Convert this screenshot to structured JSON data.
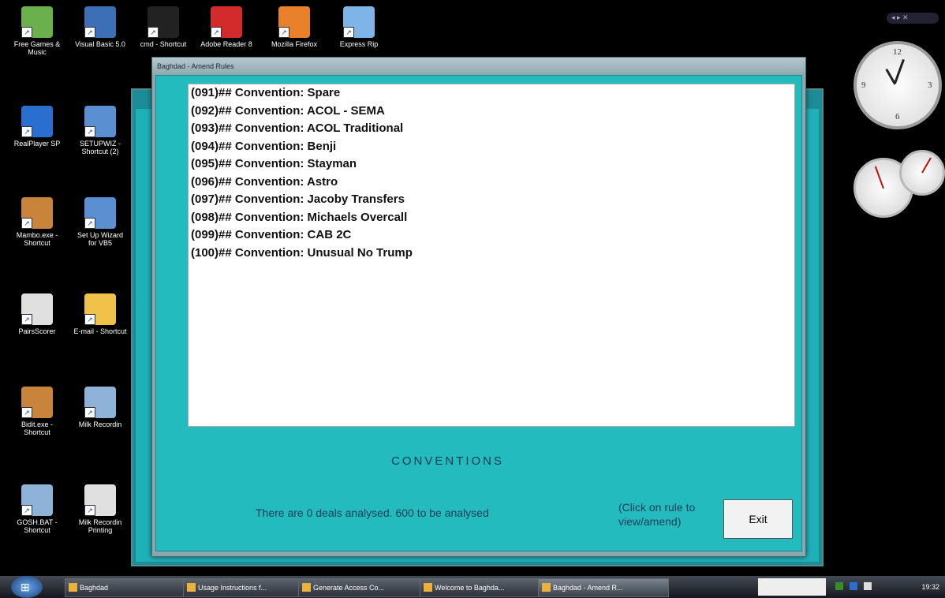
{
  "desktop": {
    "icons": [
      {
        "label": "Free Games & Music",
        "color": "#6ab04c"
      },
      {
        "label": "Visual Basic 5.0",
        "color": "#3d6fb6"
      },
      {
        "label": "cmd - Shortcut",
        "color": "#222222"
      },
      {
        "label": "Adobe Reader 8",
        "color": "#d32b2b"
      },
      {
        "label": "Mozilla Firefox",
        "color": "#e9802a"
      },
      {
        "label": "Express Rip",
        "color": "#7fb4e6"
      },
      {
        "label": "RealPlayer SP",
        "color": "#2a6fcf"
      },
      {
        "label": "SETUPWIZ - Shortcut (2)",
        "color": "#5a8fd2"
      },
      {
        "label": "Mambo.exe - Shortcut",
        "color": "#c9843b"
      },
      {
        "label": "Set Up Wizard for VB5",
        "color": "#5a8fd2"
      },
      {
        "label": "PairsScorer",
        "color": "#e0e0e0"
      },
      {
        "label": "E-mail - Shortcut",
        "color": "#f0c24a"
      },
      {
        "label": "Bidit.exe - Shortcut",
        "color": "#c9843b"
      },
      {
        "label": "Milk Recordin",
        "color": "#8fb2d8"
      },
      {
        "label": "GOSH.BAT - Shortcut",
        "color": "#8fb2d8"
      },
      {
        "label": "Milk Recordin Printing",
        "color": "#e0e0e0"
      }
    ]
  },
  "window": {
    "title": "Baghdad - Amend Rules",
    "rules": [
      "(091)## Convention: Spare",
      "(092)## Convention: ACOL - SEMA",
      "(093)## Convention: ACOL Traditional",
      "(094)## Convention: Benji",
      "(095)## Convention: Stayman",
      "(096)## Convention: Astro",
      "(097)## Convention: Jacoby Transfers",
      "(098)## Convention: Michaels Overcall",
      "(099)## Convention: CAB 2C",
      "(100)## Convention: Unusual No Trump"
    ],
    "heading": "CONVENTIONS",
    "status": "There are  0 deals analysed.  600 to be analysed",
    "hint": "(Click on rule to view/amend)",
    "exit_label": "Exit"
  },
  "taskbar": {
    "tasks": [
      {
        "label": "Baghdad",
        "active": false
      },
      {
        "label": "Usage Instructions f...",
        "active": false
      },
      {
        "label": "Generate Access Co...",
        "active": false
      },
      {
        "label": "Welcome to Baghda...",
        "active": false
      },
      {
        "label": "Baghdad - Amend R...",
        "active": true
      }
    ],
    "time": "19:32"
  },
  "colors": {
    "client_bg": "#23bbbd",
    "text_dark": "#1a3c5a"
  }
}
